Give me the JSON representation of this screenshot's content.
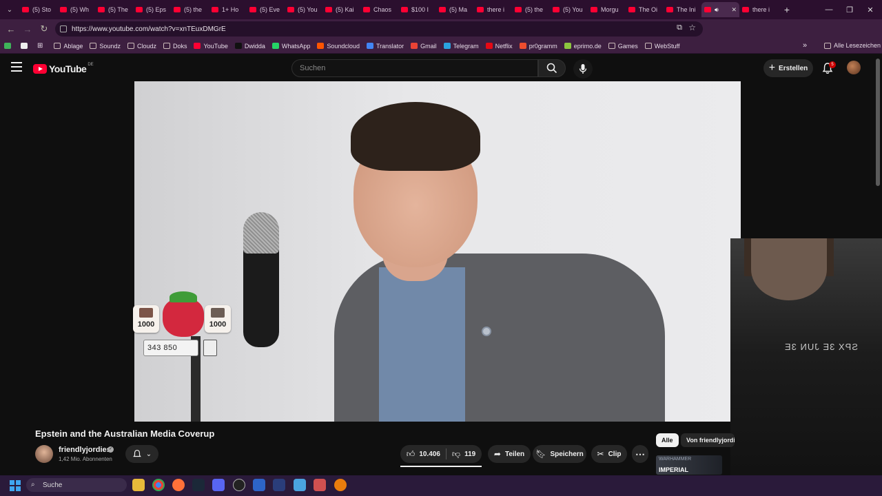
{
  "browser": {
    "tabs": [
      {
        "title": "(5) Sto"
      },
      {
        "title": "(5) Wh"
      },
      {
        "title": "(5) The"
      },
      {
        "title": "(5) Eps"
      },
      {
        "title": "(5) the"
      },
      {
        "title": "1+ Ho"
      },
      {
        "title": "(5) Eve"
      },
      {
        "title": "(5) You"
      },
      {
        "title": "(5) Kai"
      },
      {
        "title": "Chaos"
      },
      {
        "title": "$100 I"
      },
      {
        "title": "(5) Ma"
      },
      {
        "title": "there i"
      },
      {
        "title": "(5) the"
      },
      {
        "title": "(5) You"
      },
      {
        "title": "Morgu"
      },
      {
        "title": "The Oi"
      },
      {
        "title": "The Ini"
      },
      {
        "title": ""
      },
      {
        "title": "there i"
      }
    ],
    "active_tab_index": 18,
    "url": "https://www.youtube.com/watch?v=xnTEuxDMGrE",
    "bookmarks": [
      {
        "label": "Ablage",
        "icon": "folder-icon"
      },
      {
        "label": "Soundz",
        "icon": "folder-icon"
      },
      {
        "label": "Cloudz",
        "icon": "folder-icon"
      },
      {
        "label": "Doks",
        "icon": "folder-icon"
      },
      {
        "label": "YouTube",
        "icon": "youtube-icon"
      },
      {
        "label": "Dwidda",
        "icon": "x-icon"
      },
      {
        "label": "WhatsApp",
        "icon": "whatsapp-icon"
      },
      {
        "label": "Soundcloud",
        "icon": "soundcloud-icon"
      },
      {
        "label": "Translator",
        "icon": "translator-icon"
      },
      {
        "label": "Gmail",
        "icon": "gmail-icon"
      },
      {
        "label": "Telegram",
        "icon": "telegram-icon"
      },
      {
        "label": "Netflix",
        "icon": "netflix-icon"
      },
      {
        "label": "pr0gramm",
        "icon": "pr0gramm-icon"
      },
      {
        "label": "eprimo.de",
        "icon": "eprimo-icon"
      },
      {
        "label": "Games",
        "icon": "folder-icon"
      },
      {
        "label": "WebStuff",
        "icon": "folder-icon"
      }
    ],
    "bookmarks_overflow": "»",
    "all_bookmarks_label": "Alle Lesezeichen",
    "colors": {
      "tabbar": "#2b0f2e",
      "toolbar": "#3d1f40"
    }
  },
  "youtube": {
    "logo_text": "YouTube",
    "country_code": "DE",
    "search_placeholder": "Suchen",
    "create_label": "Erstellen",
    "notification_count": "5",
    "brand_color": "#ff0033"
  },
  "video": {
    "title": "Epstein and the Australian Media Coverup",
    "channel_name": "friendlyjordies",
    "subscribers": "1,42 Mio. Abonnenten",
    "likes": "10.406",
    "dislikes": "119",
    "share_label": "Teilen",
    "save_label": "Speichern",
    "clip_label": "Clip",
    "more_label": "⋯"
  },
  "overlay": {
    "counter_left": "1000",
    "counter_right": "1000",
    "score": "343 850"
  },
  "webcam": {
    "shirt_text": "SPX 3E JUN 3E"
  },
  "sidebar": {
    "chips": [
      {
        "label": "Alle"
      },
      {
        "label": "Von friendlyjordies"
      }
    ],
    "thumbnail_text_top": "WARHAMMER",
    "thumbnail_text_bottom": "IMPERIAL"
  },
  "taskbar": {
    "search_label": "Suche"
  }
}
